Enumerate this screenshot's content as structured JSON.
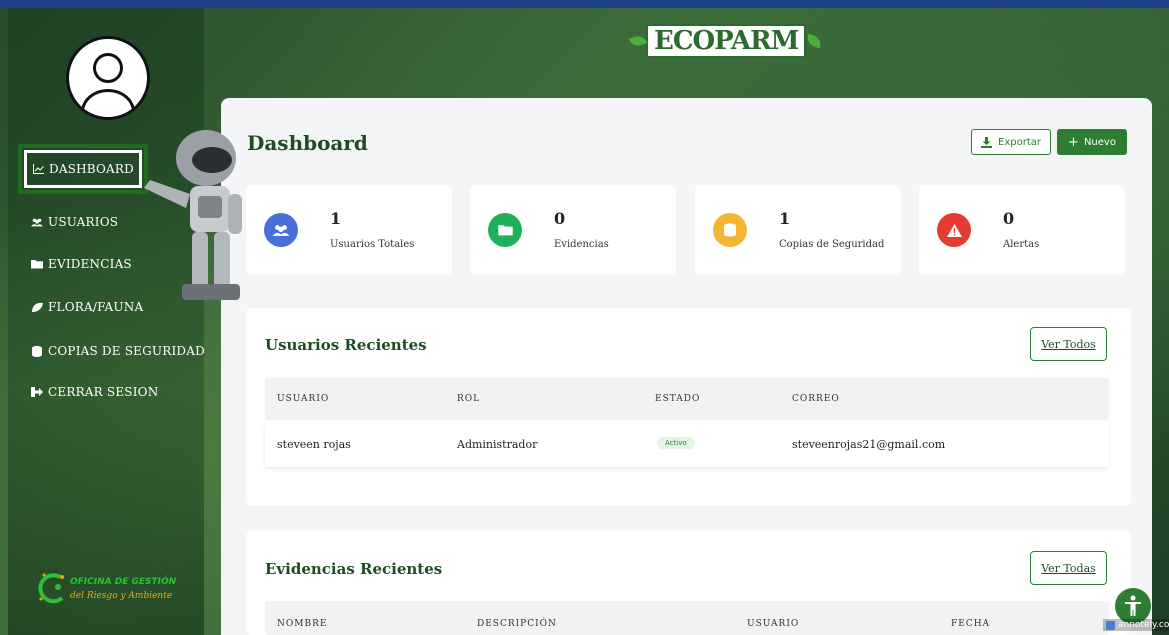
{
  "brand": {
    "name": "ECOPARM"
  },
  "sidebar": {
    "items": [
      {
        "label": "DASHBOARD",
        "icon": "chart-line-icon",
        "active": true
      },
      {
        "label": "USUARIOS",
        "icon": "users-icon"
      },
      {
        "label": "EVIDENCIAS",
        "icon": "folder-icon"
      },
      {
        "label": "FLORA/FAUNA",
        "icon": "leaf-icon"
      },
      {
        "label": "COPIAS DE SEGURIDAD",
        "icon": "database-icon"
      },
      {
        "label": "CERRAR SESION",
        "icon": "sign-out-icon"
      }
    ],
    "footer_logo": {
      "line1": "OFICINA DE GESTIÓN",
      "line2": "del Riesgo y Ambiente"
    }
  },
  "header": {
    "title": "Dashboard",
    "export_label": "Exportar",
    "new_label": "Nuevo"
  },
  "stats": [
    {
      "value": "1",
      "label": "Usuarios Totales",
      "icon": "users-icon",
      "color": "#4a6fd9"
    },
    {
      "value": "0",
      "label": "Evidencias",
      "icon": "folder-icon",
      "color": "#1fb15a"
    },
    {
      "value": "1",
      "label": "Copias de Seguridad",
      "icon": "database-icon",
      "color": "#f5b534"
    },
    {
      "value": "0",
      "label": "Alertas",
      "icon": "warning-icon",
      "color": "#e53b32"
    }
  ],
  "recent_users": {
    "title": "Usuarios Recientes",
    "button": "Ver Todos",
    "columns": [
      "USUARIO",
      "ROL",
      "ESTADO",
      "CORREO"
    ],
    "rows": [
      {
        "usuario": "steveen rojas",
        "rol": "Administrador",
        "estado": "Activo",
        "correo": "steveenrojas21@gmail.com"
      }
    ]
  },
  "recent_evidence": {
    "title": "Evidencias Recientes",
    "button": "Ver Todas",
    "columns": [
      "NOMBRE",
      "DESCRIPCIÓN",
      "USUARIO",
      "FECHA"
    ]
  },
  "watermark": "annotely.com",
  "colors": {
    "primary": "#2e7d32",
    "title": "#1f4d23"
  }
}
